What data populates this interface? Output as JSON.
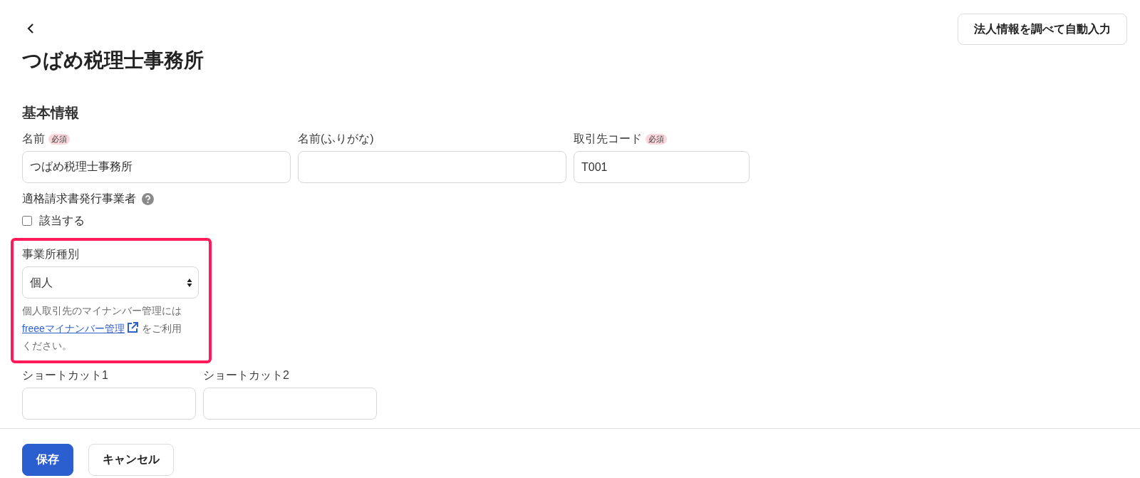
{
  "header": {
    "back_button": {
      "kind": "back"
    },
    "title": "つばめ税理士事務所",
    "autofill_button": "法人情報を調べて自動入力"
  },
  "section": {
    "heading": "基本情報",
    "name_row": [
      {
        "label": "名前",
        "required_badge": "必須",
        "value": "つばめ税理士事務所"
      },
      {
        "label": "名前(ふりがな)"
      },
      {
        "label": "取引先コード",
        "required_badge": "必須",
        "value": "T001"
      }
    ],
    "invoice_issuer": {
      "label": "適格請求書発行事業者",
      "checkbox": {
        "label": "該当する",
        "checked": false
      }
    },
    "office_type": {
      "highlighted": true,
      "label": "事業所種別",
      "value": "個人",
      "help_before": "個人取引先のマイナンバー管理には",
      "help_link": "freeeマイナンバー管理",
      "help_after": "をご利用ください。"
    },
    "shortcuts": [
      {
        "label": "ショートカット1"
      },
      {
        "label": "ショートカット2"
      }
    ]
  },
  "footer": {
    "buttons": [
      {
        "label": "保存",
        "kind": "primary"
      },
      {
        "label": "キャンセル",
        "kind": "secondary"
      }
    ]
  }
}
